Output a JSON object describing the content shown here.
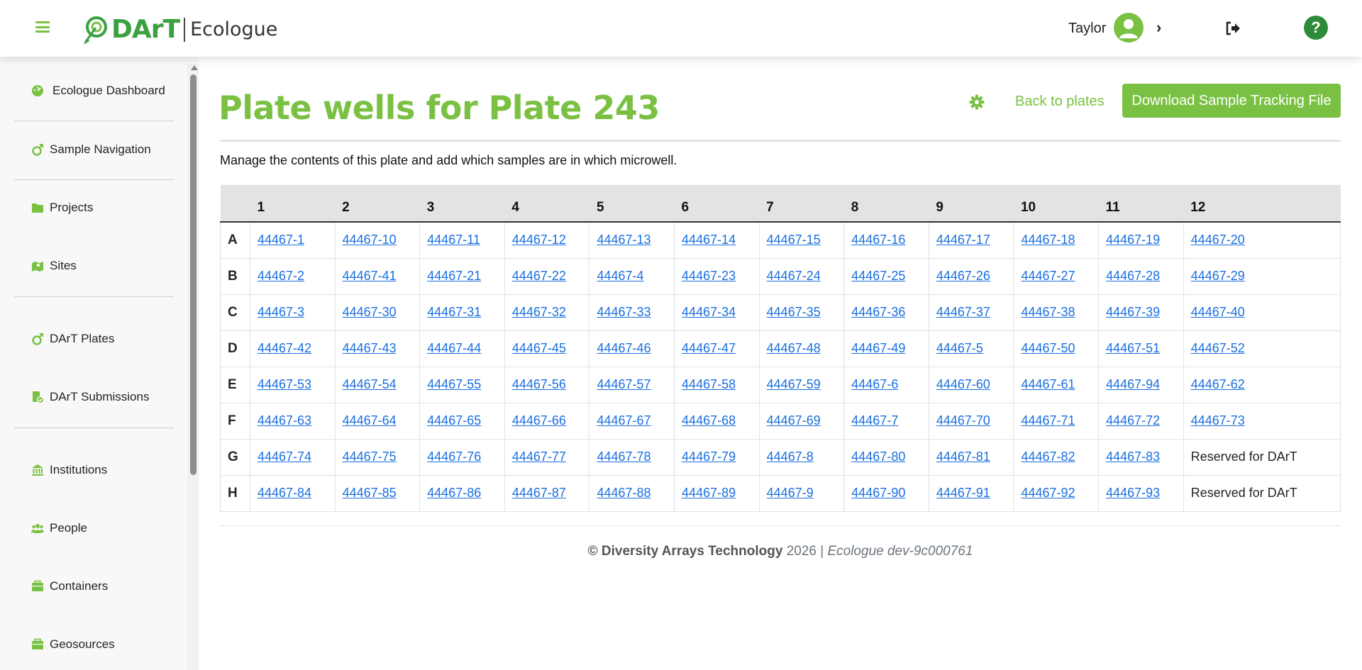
{
  "header": {
    "brand_dart": "DArT",
    "brand_app": "Ecologue",
    "user_name": "Taylor",
    "help_label": "?"
  },
  "sidebar": {
    "items": [
      {
        "label": "Ecologue Dashboard",
        "icon": "dashboard-icon"
      },
      {
        "label": "Sample Navigation",
        "icon": "sample-navigation-icon"
      },
      {
        "label": "Projects",
        "icon": "folder-icon"
      },
      {
        "label": "Sites",
        "icon": "map-marker-icon"
      },
      {
        "label": "DArT Plates",
        "icon": "plate-icon"
      },
      {
        "label": "DArT Submissions",
        "icon": "submission-icon"
      },
      {
        "label": "Institutions",
        "icon": "institution-icon"
      },
      {
        "label": "People",
        "icon": "people-icon"
      },
      {
        "label": "Containers",
        "icon": "container-icon"
      },
      {
        "label": "Geosources",
        "icon": "geosource-icon"
      }
    ]
  },
  "main": {
    "title": "Plate wells for Plate 243",
    "back_label": "Back to plates",
    "download_label": "Download Sample Tracking File",
    "description": "Manage the contents of this plate and add which samples are in which microwell.",
    "columns": [
      "1",
      "2",
      "3",
      "4",
      "5",
      "6",
      "7",
      "8",
      "9",
      "10",
      "11",
      "12"
    ],
    "rows": [
      {
        "label": "A",
        "cells": [
          {
            "text": "44467-1",
            "link": true
          },
          {
            "text": "44467-10",
            "link": true
          },
          {
            "text": "44467-11",
            "link": true
          },
          {
            "text": "44467-12",
            "link": true
          },
          {
            "text": "44467-13",
            "link": true
          },
          {
            "text": "44467-14",
            "link": true
          },
          {
            "text": "44467-15",
            "link": true
          },
          {
            "text": "44467-16",
            "link": true
          },
          {
            "text": "44467-17",
            "link": true
          },
          {
            "text": "44467-18",
            "link": true
          },
          {
            "text": "44467-19",
            "link": true
          },
          {
            "text": "44467-20",
            "link": true
          }
        ]
      },
      {
        "label": "B",
        "cells": [
          {
            "text": "44467-2",
            "link": true
          },
          {
            "text": "44467-41",
            "link": true
          },
          {
            "text": "44467-21",
            "link": true
          },
          {
            "text": "44467-22",
            "link": true
          },
          {
            "text": "44467-4",
            "link": true
          },
          {
            "text": "44467-23",
            "link": true
          },
          {
            "text": "44467-24",
            "link": true
          },
          {
            "text": "44467-25",
            "link": true
          },
          {
            "text": "44467-26",
            "link": true
          },
          {
            "text": "44467-27",
            "link": true
          },
          {
            "text": "44467-28",
            "link": true
          },
          {
            "text": "44467-29",
            "link": true
          }
        ]
      },
      {
        "label": "C",
        "cells": [
          {
            "text": "44467-3",
            "link": true
          },
          {
            "text": "44467-30",
            "link": true
          },
          {
            "text": "44467-31",
            "link": true
          },
          {
            "text": "44467-32",
            "link": true
          },
          {
            "text": "44467-33",
            "link": true
          },
          {
            "text": "44467-34",
            "link": true
          },
          {
            "text": "44467-35",
            "link": true
          },
          {
            "text": "44467-36",
            "link": true
          },
          {
            "text": "44467-37",
            "link": true
          },
          {
            "text": "44467-38",
            "link": true
          },
          {
            "text": "44467-39",
            "link": true
          },
          {
            "text": "44467-40",
            "link": true
          }
        ]
      },
      {
        "label": "D",
        "cells": [
          {
            "text": "44467-42",
            "link": true
          },
          {
            "text": "44467-43",
            "link": true
          },
          {
            "text": "44467-44",
            "link": true
          },
          {
            "text": "44467-45",
            "link": true
          },
          {
            "text": "44467-46",
            "link": true
          },
          {
            "text": "44467-47",
            "link": true
          },
          {
            "text": "44467-48",
            "link": true
          },
          {
            "text": "44467-49",
            "link": true
          },
          {
            "text": "44467-5",
            "link": true
          },
          {
            "text": "44467-50",
            "link": true
          },
          {
            "text": "44467-51",
            "link": true
          },
          {
            "text": "44467-52",
            "link": true
          }
        ]
      },
      {
        "label": "E",
        "cells": [
          {
            "text": "44467-53",
            "link": true
          },
          {
            "text": "44467-54",
            "link": true
          },
          {
            "text": "44467-55",
            "link": true
          },
          {
            "text": "44467-56",
            "link": true
          },
          {
            "text": "44467-57",
            "link": true
          },
          {
            "text": "44467-58",
            "link": true
          },
          {
            "text": "44467-59",
            "link": true
          },
          {
            "text": "44467-6",
            "link": true
          },
          {
            "text": "44467-60",
            "link": true
          },
          {
            "text": "44467-61",
            "link": true
          },
          {
            "text": "44467-94",
            "link": true
          },
          {
            "text": "44467-62",
            "link": true
          }
        ]
      },
      {
        "label": "F",
        "cells": [
          {
            "text": "44467-63",
            "link": true
          },
          {
            "text": "44467-64",
            "link": true
          },
          {
            "text": "44467-65",
            "link": true
          },
          {
            "text": "44467-66",
            "link": true
          },
          {
            "text": "44467-67",
            "link": true
          },
          {
            "text": "44467-68",
            "link": true
          },
          {
            "text": "44467-69",
            "link": true
          },
          {
            "text": "44467-7",
            "link": true
          },
          {
            "text": "44467-70",
            "link": true
          },
          {
            "text": "44467-71",
            "link": true
          },
          {
            "text": "44467-72",
            "link": true
          },
          {
            "text": "44467-73",
            "link": true
          }
        ]
      },
      {
        "label": "G",
        "cells": [
          {
            "text": "44467-74",
            "link": true
          },
          {
            "text": "44467-75",
            "link": true
          },
          {
            "text": "44467-76",
            "link": true
          },
          {
            "text": "44467-77",
            "link": true
          },
          {
            "text": "44467-78",
            "link": true
          },
          {
            "text": "44467-79",
            "link": true
          },
          {
            "text": "44467-8",
            "link": true
          },
          {
            "text": "44467-80",
            "link": true
          },
          {
            "text": "44467-81",
            "link": true
          },
          {
            "text": "44467-82",
            "link": true
          },
          {
            "text": "44467-83",
            "link": true
          },
          {
            "text": "Reserved for DArT",
            "link": false
          }
        ]
      },
      {
        "label": "H",
        "cells": [
          {
            "text": "44467-84",
            "link": true
          },
          {
            "text": "44467-85",
            "link": true
          },
          {
            "text": "44467-86",
            "link": true
          },
          {
            "text": "44467-87",
            "link": true
          },
          {
            "text": "44467-88",
            "link": true
          },
          {
            "text": "44467-89",
            "link": true
          },
          {
            "text": "44467-9",
            "link": true
          },
          {
            "text": "44467-90",
            "link": true
          },
          {
            "text": "44467-91",
            "link": true
          },
          {
            "text": "44467-92",
            "link": true
          },
          {
            "text": "44467-93",
            "link": true
          },
          {
            "text": "Reserved for DArT",
            "link": false
          }
        ]
      }
    ]
  },
  "footer": {
    "company": "© Diversity Arrays Technology",
    "year": "2026 |",
    "version": "Ecologue dev-9c000761"
  },
  "colors": {
    "brand_green": "#7ac143",
    "dark_green": "#2e8b3a",
    "link_blue": "#1a6fe0"
  }
}
